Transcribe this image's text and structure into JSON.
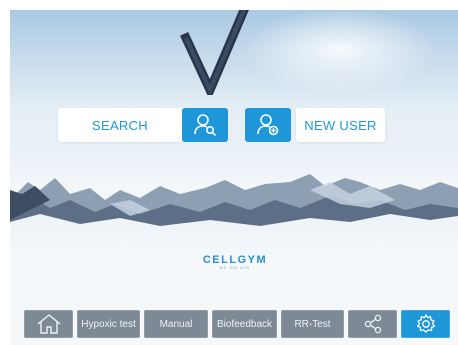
{
  "main": {
    "search_label": "SEARCH",
    "new_user_label": "NEW USER",
    "icons": {
      "search_user": "user-search-icon",
      "add_user": "user-add-icon"
    }
  },
  "brand": {
    "name": "CELLGYM",
    "tagline": "BE ON AIR"
  },
  "nav": {
    "items": [
      {
        "label": "",
        "icon": "home-icon"
      },
      {
        "label": "Hypoxic test"
      },
      {
        "label": "Manual"
      },
      {
        "label": "Biofeedback"
      },
      {
        "label": "RR-Test"
      },
      {
        "label": "",
        "icon": "share-icon"
      },
      {
        "label": "",
        "icon": "gear-icon",
        "active": true
      }
    ]
  },
  "colors": {
    "accent": "#1e96d7",
    "nav_button": "#7d8a96",
    "text_blue": "#1f9ad6"
  }
}
